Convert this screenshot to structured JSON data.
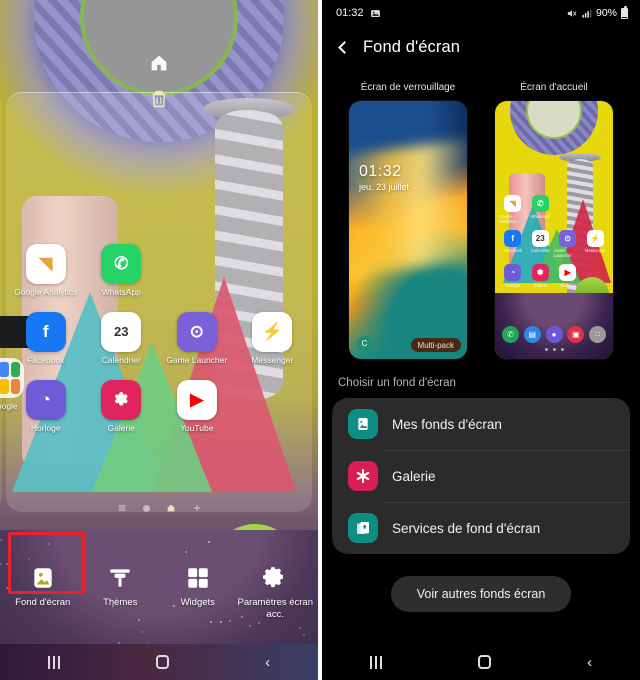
{
  "left_panel": {
    "name": "home-screen-edit-mode",
    "top_actions": [
      {
        "name": "home-icon",
        "label": "Accueil"
      },
      {
        "name": "trash-icon",
        "label": "Supprimer"
      }
    ],
    "mic_widget": {
      "icon": "microphone-icon"
    },
    "apps": [
      {
        "label": "Google Analytics",
        "icon": "google-analytics-icon",
        "color": "#ffffff",
        "glyph": "◥"
      },
      {
        "label": "WhatsApp",
        "icon": "whatsapp-icon",
        "color": "#25d366",
        "glyph": "✆"
      },
      {
        "label": "",
        "icon": "empty-slot",
        "color": "transparent",
        "glyph": ""
      },
      {
        "label": "",
        "icon": "empty-slot",
        "color": "transparent",
        "glyph": ""
      },
      {
        "label": "Facebook",
        "icon": "facebook-icon",
        "color": "#1877f2",
        "glyph": "f"
      },
      {
        "label": "Calendrier",
        "icon": "calendar-icon",
        "color": "#ffffff",
        "glyph": "23"
      },
      {
        "label": "Game Launcher",
        "icon": "game-launcher-icon",
        "color": "#7b61d8",
        "glyph": "⊙"
      },
      {
        "label": "Messenger",
        "icon": "messenger-icon",
        "color": "#ffffff",
        "glyph": "⚡"
      },
      {
        "label": "Horloge",
        "icon": "clock-icon",
        "color": "#6f5bd6",
        "glyph": "◔"
      },
      {
        "label": "Galerie",
        "icon": "gallery-icon",
        "color": "#e0245e",
        "glyph": "✽"
      },
      {
        "label": "YouTube",
        "icon": "youtube-icon",
        "color": "#ffffff",
        "glyph": "▶"
      },
      {
        "label": "",
        "icon": "empty-slot",
        "color": "transparent",
        "glyph": ""
      }
    ],
    "google_folder": {
      "label": "Google",
      "icon": "google-folder-icon"
    },
    "pager": {
      "icons": [
        "list-icon",
        "dot-icon",
        "home-icon",
        "plus-icon"
      ],
      "active_index": 2
    },
    "toolbar": [
      {
        "label": "Fond d'écran",
        "icon": "wallpaper-icon",
        "highlighted": true
      },
      {
        "label": "Thèmes",
        "icon": "themes-brush-icon",
        "highlighted": false
      },
      {
        "label": "Widgets",
        "icon": "widgets-icon",
        "highlighted": false
      },
      {
        "label": "Paramètres écran acc.",
        "icon": "settings-gear-icon",
        "highlighted": false
      }
    ],
    "navbar": [
      {
        "name": "recents-button",
        "glyph": "|||"
      },
      {
        "name": "home-button",
        "glyph": "O"
      },
      {
        "name": "back-button",
        "glyph": "‹"
      }
    ]
  },
  "right_panel": {
    "statusbar": {
      "time": "01:32",
      "left_icons": [
        "image-icon"
      ],
      "mute_icon": "mute-icon",
      "signal_icon": "signal-bars-icon",
      "battery_percent": "90%",
      "battery_icon": "battery-icon"
    },
    "appbar": {
      "back_icon": "back-chevron-icon",
      "title": "Fond d'écran"
    },
    "previews": [
      {
        "caption": "Écran de verrouillage",
        "name": "lock-screen-preview",
        "clock_time": "01:32",
        "clock_date": "jeu. 23 juillet",
        "badge": "Multi-pack",
        "shortcut_glyph": "C"
      },
      {
        "caption": "Écran d'accueil",
        "name": "home-screen-preview"
      }
    ],
    "section_title": "Choisir un fond d'écran",
    "options": [
      {
        "label": "Mes fonds d'écran",
        "icon": "my-wallpapers-icon",
        "color": "#0f8f84"
      },
      {
        "label": "Galerie",
        "icon": "gallery-icon",
        "color": "#d91e54"
      },
      {
        "label": "Services de fond d'écran",
        "icon": "wallpaper-services-icon",
        "color": "#0f8f84"
      }
    ],
    "more_button": "Voir autres fonds écran",
    "navbar": [
      {
        "name": "recents-button",
        "glyph": "|||"
      },
      {
        "name": "home-button",
        "glyph": "O"
      },
      {
        "name": "back-button",
        "glyph": "‹"
      }
    ]
  },
  "preview_apps": [
    {
      "label": "Google Analytics",
      "color": "#ffffff",
      "glyph": "◥",
      "text": "#e8a33d"
    },
    {
      "label": "WhatsApp",
      "color": "#25d366",
      "glyph": "✆",
      "text": "#ffffff"
    },
    {
      "label": "",
      "color": "transparent",
      "glyph": "",
      "text": "#ffffff"
    },
    {
      "label": "",
      "color": "transparent",
      "glyph": "",
      "text": "#ffffff"
    },
    {
      "label": "Facebook",
      "color": "#1877f2",
      "glyph": "f",
      "text": "#ffffff"
    },
    {
      "label": "Calendrier",
      "color": "#ffffff",
      "glyph": "23",
      "text": "#333333"
    },
    {
      "label": "Game Launcher",
      "color": "#7b61d8",
      "glyph": "⊙",
      "text": "#ffffff"
    },
    {
      "label": "Messenger",
      "color": "#ffffff",
      "glyph": "⚡",
      "text": "#2196f3"
    },
    {
      "label": "Horloge",
      "color": "#6f5bd6",
      "glyph": "◔",
      "text": "#ffffff"
    },
    {
      "label": "Galerie",
      "color": "#e0245e",
      "glyph": "✽",
      "text": "#ffffff"
    },
    {
      "label": "YouTube",
      "color": "#ffffff",
      "glyph": "▶",
      "text": "#ff0000"
    },
    {
      "label": "",
      "color": "transparent",
      "glyph": "",
      "text": "#ffffff"
    }
  ],
  "preview_dock": [
    {
      "name": "phone-icon",
      "color": "#22a55b",
      "glyph": "✆"
    },
    {
      "name": "messages-icon",
      "color": "#2f86e8",
      "glyph": "▤"
    },
    {
      "name": "internet-icon",
      "color": "#6a5ad8",
      "glyph": "●"
    },
    {
      "name": "camera-icon",
      "color": "#e0324a",
      "glyph": "▣"
    },
    {
      "name": "apps-grid-icon",
      "color": "#9a9a9a",
      "glyph": "∷"
    }
  ]
}
